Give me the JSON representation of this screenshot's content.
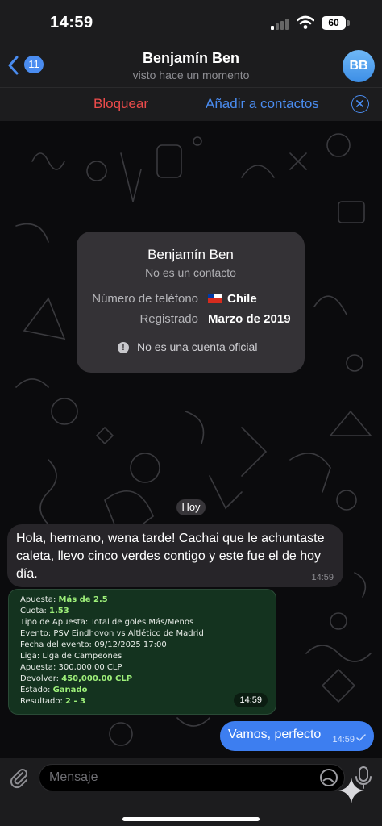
{
  "status_bar": {
    "time": "14:59",
    "battery": "60"
  },
  "header": {
    "back_badge": "11",
    "title": "Benjamín Ben",
    "subtitle": "visto hace un momento",
    "avatar_initials": "BB"
  },
  "action_bar": {
    "block_label": "Bloquear",
    "add_contact_label": "Añadir a contactos"
  },
  "info_card": {
    "name": "Benjamín Ben",
    "note": "No es un contacto",
    "phone_label": "Número de teléfono",
    "phone_value": "Chile",
    "registered_label": "Registrado",
    "registered_value": "Marzo de 2019",
    "warning": "No es una cuenta oficial"
  },
  "date_chip": "Hoy",
  "messages": [
    {
      "direction": "in",
      "text": "Hola, hermano, wena tarde! Cachai que le achuntaste caleta, llevo cinco verdes contigo y este fue el de hoy día.",
      "time": "14:59"
    },
    {
      "direction": "in",
      "type": "image",
      "time": "14:59",
      "lines": [
        {
          "label": "Apuesta: ",
          "value": "Más de 2.5",
          "highlight": true
        },
        {
          "label": "Cuota: ",
          "value": "1.53",
          "highlight": true
        },
        {
          "label": "Tipo de Apuesta: ",
          "value": "Total de goles Más/Menos",
          "highlight": false
        },
        {
          "label": "Evento: ",
          "value": "PSV Eindhovon vs Altlético de Madrid",
          "highlight": false
        },
        {
          "label": "Fecha del evento: ",
          "value": "09/12/2025 17:00",
          "highlight": false
        },
        {
          "label": "Liga: ",
          "value": "Liga de Campeones",
          "highlight": false
        },
        {
          "label": "Apuesta: ",
          "value": "300,000.00 CLP",
          "highlight": false
        },
        {
          "label": "Devolver: ",
          "value": "450,000.00 CLP",
          "highlight": true
        },
        {
          "label": "Estado: ",
          "value": "Ganado",
          "highlight": true
        },
        {
          "label": "Resultado: ",
          "value": "2 - 3",
          "highlight": true
        }
      ]
    },
    {
      "direction": "out",
      "text": "Vamos, perfecto",
      "time": "14:59"
    }
  ],
  "input_bar": {
    "placeholder": "Mensaje"
  },
  "colors": {
    "accent": "#4a8cf0",
    "danger": "#ec4b4b",
    "outgoing_bubble": "#3d7ef0",
    "incoming_bubble": "#272529",
    "bet_highlight": "#9ef07a"
  },
  "icons": [
    "chevron-left-icon",
    "close-circle-icon",
    "warning-icon",
    "paperclip-icon",
    "sticker-icon",
    "microphone-icon",
    "double-check-icon",
    "sparkle-icon"
  ]
}
